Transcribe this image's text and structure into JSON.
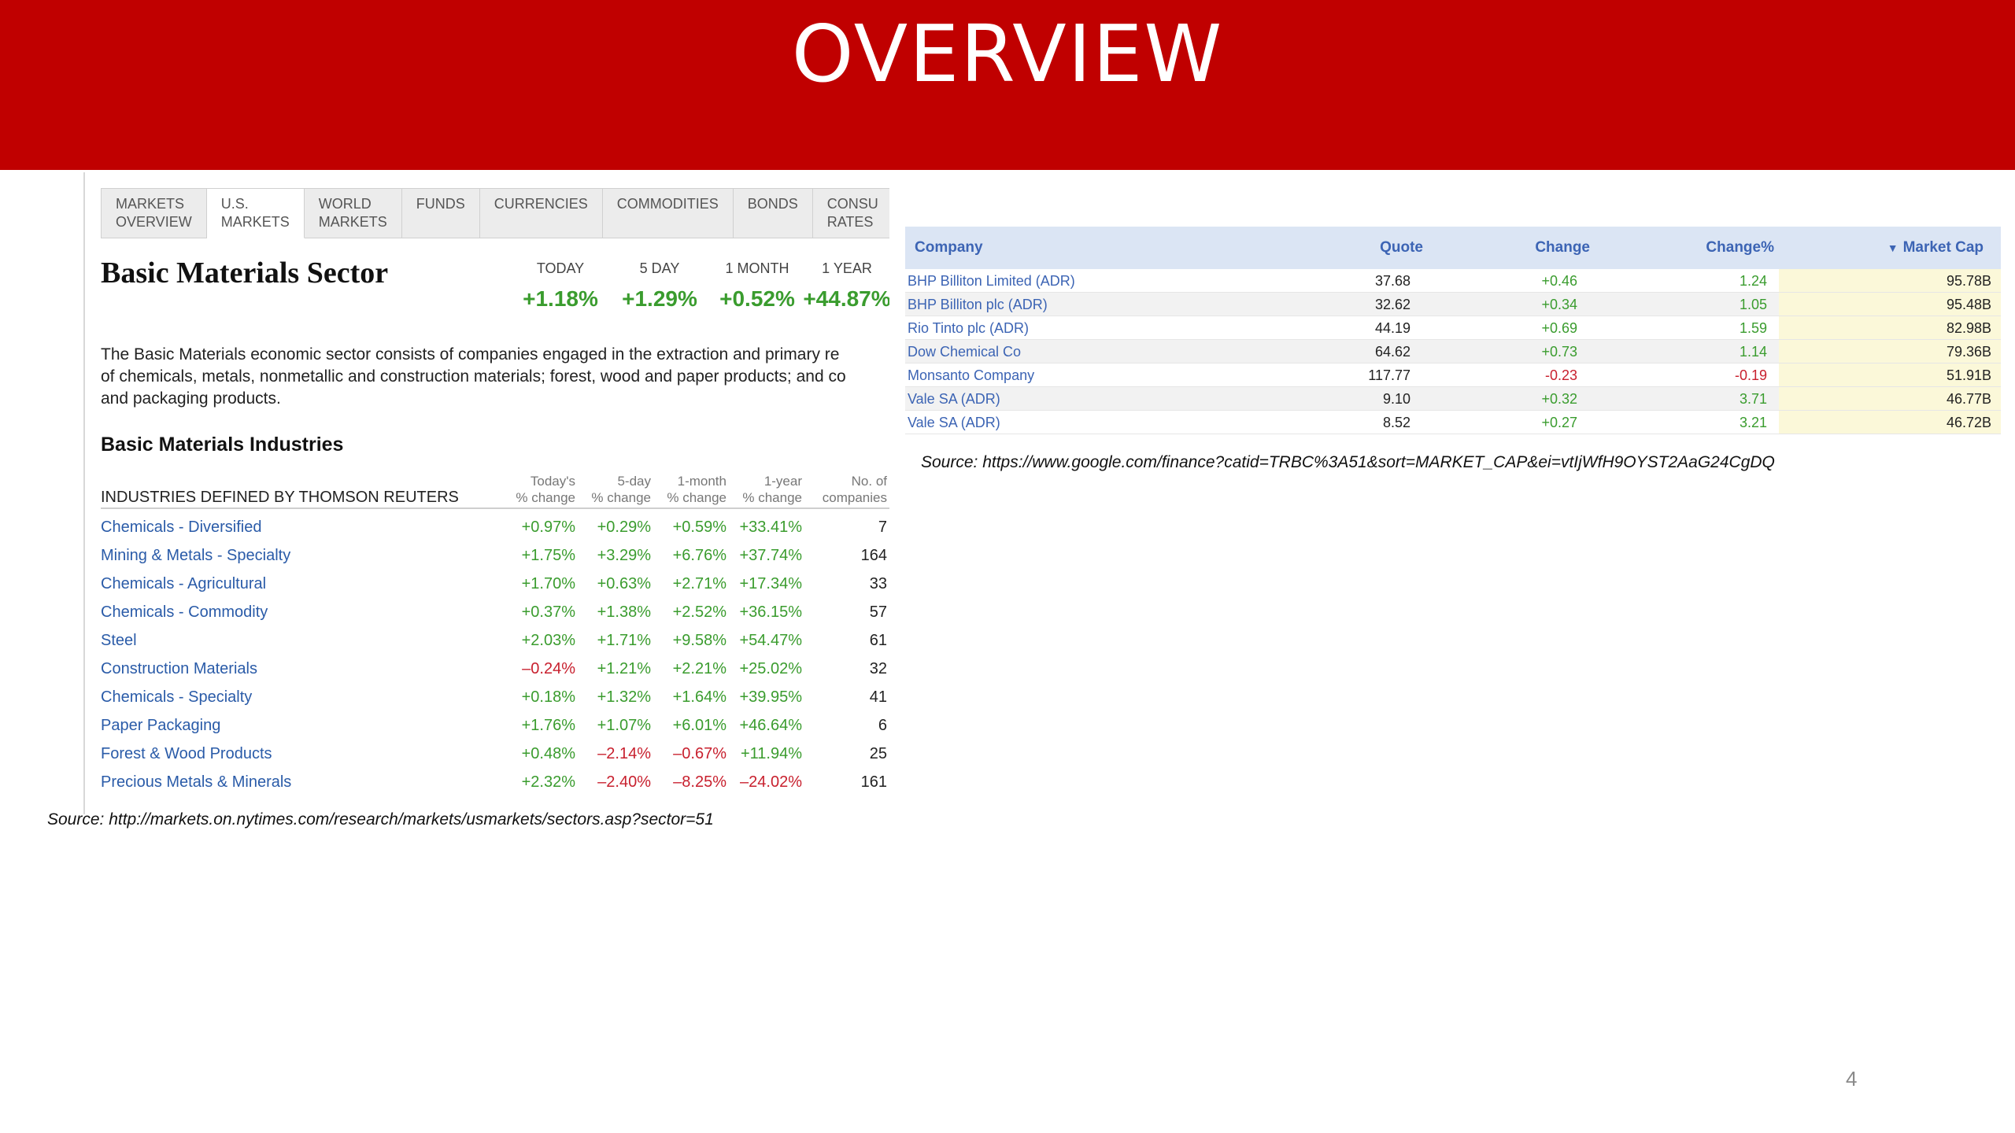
{
  "slide": {
    "title": "OVERVIEW",
    "page_number": "4"
  },
  "left": {
    "tabs": [
      {
        "line1": "MARKETS",
        "line2": "OVERVIEW"
      },
      {
        "line1": "U.S.",
        "line2": "MARKETS"
      },
      {
        "line1": "WORLD",
        "line2": "MARKETS"
      },
      {
        "line1": "FUNDS",
        "line2": ""
      },
      {
        "line1": "CURRENCIES",
        "line2": ""
      },
      {
        "line1": "COMMODITIES",
        "line2": ""
      },
      {
        "line1": "BONDS",
        "line2": ""
      },
      {
        "line1": "CONSU",
        "line2": "RATES"
      }
    ],
    "sector_title": "Basic Materials Sector",
    "performance": [
      {
        "label": "TODAY",
        "value": "+1.18%"
      },
      {
        "label": "5 DAY",
        "value": "+1.29%"
      },
      {
        "label": "1 MONTH",
        "value": "+0.52%"
      },
      {
        "label": "1 YEAR",
        "value": "+44.87%"
      }
    ],
    "description": [
      "The Basic Materials economic sector consists of companies engaged in the extraction and primary re",
      "of chemicals, metals, nonmetallic and construction materials; forest, wood and paper products; and co",
      "and packaging products."
    ],
    "industries_heading": "Basic Materials Industries",
    "industries_defined": "INDUSTRIES DEFINED BY THOMSON REUTERS",
    "columns": [
      {
        "line1": "Today's",
        "line2": "% change"
      },
      {
        "line1": "5-day",
        "line2": "% change"
      },
      {
        "line1": "1-month",
        "line2": "% change"
      },
      {
        "line1": "1-year",
        "line2": "% change"
      },
      {
        "line1": "No. of",
        "line2": "companies"
      }
    ],
    "industries": [
      {
        "name": "Chemicals - Diversified",
        "today": "+0.97%",
        "d5": "+0.29%",
        "m1": "+0.59%",
        "y1": "+33.41%",
        "count": "7"
      },
      {
        "name": "Mining & Metals - Specialty",
        "today": "+1.75%",
        "d5": "+3.29%",
        "m1": "+6.76%",
        "y1": "+37.74%",
        "count": "164"
      },
      {
        "name": "Chemicals - Agricultural",
        "today": "+1.70%",
        "d5": "+0.63%",
        "m1": "+2.71%",
        "y1": "+17.34%",
        "count": "33"
      },
      {
        "name": "Chemicals - Commodity",
        "today": "+0.37%",
        "d5": "+1.38%",
        "m1": "+2.52%",
        "y1": "+36.15%",
        "count": "57"
      },
      {
        "name": "Steel",
        "today": "+2.03%",
        "d5": "+1.71%",
        "m1": "+9.58%",
        "y1": "+54.47%",
        "count": "61"
      },
      {
        "name": "Construction Materials",
        "today": "–0.24%",
        "d5": "+1.21%",
        "m1": "+2.21%",
        "y1": "+25.02%",
        "count": "32"
      },
      {
        "name": "Chemicals - Specialty",
        "today": "+0.18%",
        "d5": "+1.32%",
        "m1": "+1.64%",
        "y1": "+39.95%",
        "count": "41"
      },
      {
        "name": "Paper Packaging",
        "today": "+1.76%",
        "d5": "+1.07%",
        "m1": "+6.01%",
        "y1": "+46.64%",
        "count": "6"
      },
      {
        "name": "Forest & Wood Products",
        "today": "+0.48%",
        "d5": "–2.14%",
        "m1": "–0.67%",
        "y1": "+11.94%",
        "count": "25"
      },
      {
        "name": "Precious Metals & Minerals",
        "today": "+2.32%",
        "d5": "–2.40%",
        "m1": "–8.25%",
        "y1": "–24.02%",
        "count": "161"
      }
    ],
    "source": "Source: http://markets.on.nytimes.com/research/markets/usmarkets/sectors.asp?sector=51"
  },
  "right": {
    "headers": {
      "company": "Company",
      "quote": "Quote",
      "change": "Change",
      "change_pct": "Change%",
      "market_cap": "Market Cap",
      "sort_icon": "sort-desc-icon"
    },
    "rows": [
      {
        "company": "BHP Billiton Limited (ADR)",
        "quote": "37.68",
        "change": "+0.46",
        "change_pct": "1.24",
        "market_cap": "95.78B"
      },
      {
        "company": "BHP Billiton plc (ADR)",
        "quote": "32.62",
        "change": "+0.34",
        "change_pct": "1.05",
        "market_cap": "95.48B"
      },
      {
        "company": "Rio Tinto plc (ADR)",
        "quote": "44.19",
        "change": "+0.69",
        "change_pct": "1.59",
        "market_cap": "82.98B"
      },
      {
        "company": "Dow Chemical Co",
        "quote": "64.62",
        "change": "+0.73",
        "change_pct": "1.14",
        "market_cap": "79.36B"
      },
      {
        "company": "Monsanto Company",
        "quote": "117.77",
        "change": "-0.23",
        "change_pct": "-0.19",
        "market_cap": "51.91B"
      },
      {
        "company": "Vale SA (ADR)",
        "quote": "9.10",
        "change": "+0.32",
        "change_pct": "3.71",
        "market_cap": "46.77B"
      },
      {
        "company": "Vale SA (ADR)",
        "quote": "8.52",
        "change": "+0.27",
        "change_pct": "3.21",
        "market_cap": "46.72B"
      }
    ],
    "source": "Source: https://www.google.com/finance?catid=TRBC%3A51&sort=MARKET_CAP&ei=vtIjWfH9OYST2AaG24CgDQ"
  },
  "colors": {
    "banner": "#c00000",
    "positive": "#3a9c2e",
    "negative": "#c8202e",
    "link": "#2a5ba8"
  }
}
